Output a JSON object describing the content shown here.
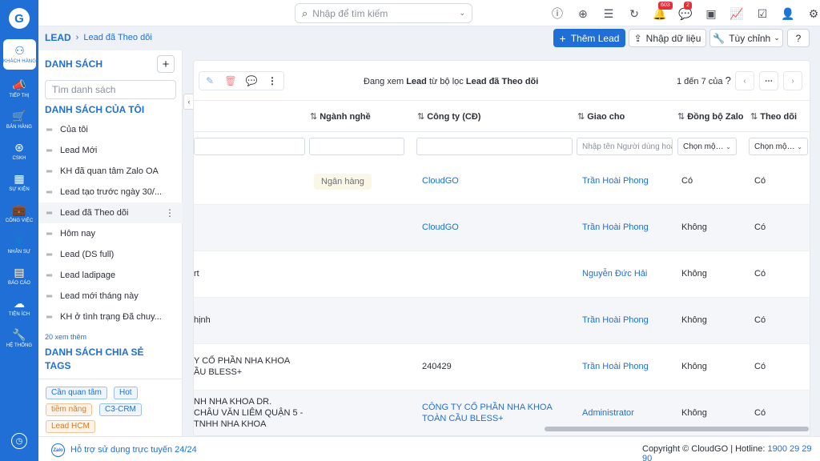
{
  "rail": {
    "logo": "G",
    "items": [
      {
        "icon": "users-icon",
        "glyph": "⚇",
        "label": "KHÁCH HÀNG",
        "active": true
      },
      {
        "icon": "megaphone-icon",
        "glyph": "📣",
        "label": "TIẾP THỊ",
        "active": false
      },
      {
        "icon": "cart-icon",
        "glyph": "🛒",
        "label": "BÁN HÀNG",
        "active": false
      },
      {
        "icon": "support-icon",
        "glyph": "⊛",
        "label": "CSKH",
        "active": false
      },
      {
        "icon": "calendar-icon",
        "glyph": "▦",
        "label": "SỰ KIỆN",
        "active": false
      },
      {
        "icon": "briefcase-icon",
        "glyph": "💼",
        "label": "CÔNG VIỆC",
        "active": false
      },
      {
        "icon": "person-icon",
        "glyph": "👤",
        "label": "NHÂN SỰ",
        "active": false
      },
      {
        "icon": "report-icon",
        "glyph": "▤",
        "label": "BÁO CÁO",
        "active": false
      },
      {
        "icon": "utility-icon",
        "glyph": "☁",
        "label": "TIỆN ÍCH",
        "active": false
      },
      {
        "icon": "wrench-icon",
        "glyph": "🔧",
        "label": "HỆ THỐNG",
        "active": false
      }
    ]
  },
  "topbar": {
    "search_placeholder": "Nhập để tìm kiếm",
    "icons": [
      {
        "name": "alert-icon",
        "glyph": "ⓘ",
        "badge": ""
      },
      {
        "name": "add-circle-icon",
        "glyph": "⊕",
        "badge": ""
      },
      {
        "name": "list-icon",
        "glyph": "☰",
        "badge": ""
      },
      {
        "name": "refresh-icon",
        "glyph": "↻",
        "badge": ""
      },
      {
        "name": "bell-icon",
        "glyph": "🔔",
        "badge": "603"
      },
      {
        "name": "chat-icon",
        "glyph": "💬",
        "badge": "2"
      },
      {
        "name": "calendar-icon",
        "glyph": "▣",
        "badge": ""
      },
      {
        "name": "chart-icon",
        "glyph": "📈",
        "badge": ""
      },
      {
        "name": "checkbox-icon",
        "glyph": "☑",
        "badge": ""
      },
      {
        "name": "user-icon",
        "glyph": "👤",
        "badge": ""
      },
      {
        "name": "settings-icon",
        "glyph": "⚙",
        "badge": ""
      }
    ]
  },
  "breadcrumb": {
    "root": "LEAD",
    "current": "Lead đã Theo dõi"
  },
  "actions": {
    "add_lead": "Thêm Lead",
    "import": "Nhập dữ liệu",
    "customize": "Tùy chỉnh"
  },
  "panel": {
    "title": "DANH SÁCH",
    "search_placeholder": "Tìm danh sách",
    "my_lists_title": "DANH SÁCH CỦA TÔI",
    "items": [
      "Của tôi",
      "Lead Mới",
      "KH đã quan tâm Zalo OA",
      "Lead tạo trước ngày 30/...",
      "Lead đã Theo dõi",
      "Hôm nay",
      "Lead (DS full)",
      "Lead ladipage",
      "Lead mới tháng này",
      "KH ở tình trạng Đã chuy..."
    ],
    "selected_index": 4,
    "more_text": "20 xem thêm",
    "shared_title": "DANH SÁCH CHIA SẺ",
    "tags_title": "TAGS",
    "tags": [
      {
        "label": "Cần quan tâm",
        "color": "#1f6fd6",
        "bg": "#eef5fd"
      },
      {
        "label": "Hot",
        "color": "#1f6fd6",
        "bg": "#eef5fd"
      },
      {
        "label": "tiềm năng",
        "color": "#d97a1f",
        "bg": "#fdf3e8"
      },
      {
        "label": "C3-CRM",
        "color": "#1f6fd6",
        "bg": "#eef5fd"
      },
      {
        "label": "Lead HCM",
        "color": "#d97a1f",
        "bg": "#fdf3e8"
      }
    ]
  },
  "main": {
    "viewing_prefix": "Đang xem",
    "viewing_module": "Lead",
    "viewing_mid": "từ bộ lọc",
    "viewing_filter": "Lead đã Theo dõi",
    "pager_text": "1 đến 7 của",
    "pager_q": "?",
    "columns": {
      "industry": "Ngành nghề",
      "company": "Công ty (CĐ)",
      "assigned": "Giao cho",
      "zalo_sync": "Đồng bộ Zalo",
      "follow": "Theo dõi"
    },
    "filters": {
      "assigned_placeholder": "Nhập tên Người dùng hoặc Nhóm",
      "zalo_placeholder": "Chọn một giá trị",
      "follow_placeholder": "Chọn một giá trị"
    },
    "rows": [
      {
        "name": [
          "",
          ""
        ],
        "industry": "Ngân hàng",
        "company": [
          "CloudGO",
          ""
        ],
        "assigned": "Trần Hoài Phong",
        "zalo": "Có",
        "follow": "Có"
      },
      {
        "name": [
          "",
          ""
        ],
        "industry": "",
        "company": [
          "CloudGO",
          ""
        ],
        "assigned": "Trần Hoài Phong",
        "zalo": "Không",
        "follow": "Có"
      },
      {
        "name": [
          "rt",
          ""
        ],
        "industry": "",
        "company": [
          "",
          ""
        ],
        "assigned": "Nguyễn Đức Hải",
        "zalo": "Không",
        "follow": "Có"
      },
      {
        "name": [
          "hịnh",
          ""
        ],
        "industry": "",
        "company": [
          "",
          ""
        ],
        "assigned": "Trần Hoài Phong",
        "zalo": "Không",
        "follow": "Có"
      },
      {
        "name": [
          "Y CỔ PHẦN NHA KHOA",
          "ẦU BLESS+"
        ],
        "industry": "",
        "company": [
          "240429",
          ""
        ],
        "assigned": "Trần Hoài Phong",
        "zalo": "Không",
        "follow": "Có"
      },
      {
        "name": [
          "NH NHA KHOA DR.",
          "CHÂU VĂN LIÊM QUẬN 5 -",
          "TNHH NHA KHOA"
        ],
        "industry": "",
        "company": [
          "CÔNG TY CỔ PHẦN NHA KHOA",
          "TOÀN CẦU BLESS+"
        ],
        "assigned": "Administrator",
        "zalo": "Không",
        "follow": "Có"
      }
    ]
  },
  "footer": {
    "zalo_label": "Zalo",
    "help": "Hỗ trợ sử dụng trực tuyến 24/24",
    "copyright": "Copyright © CloudGO | Hotline:",
    "hotline": "1900 29 29 90"
  }
}
